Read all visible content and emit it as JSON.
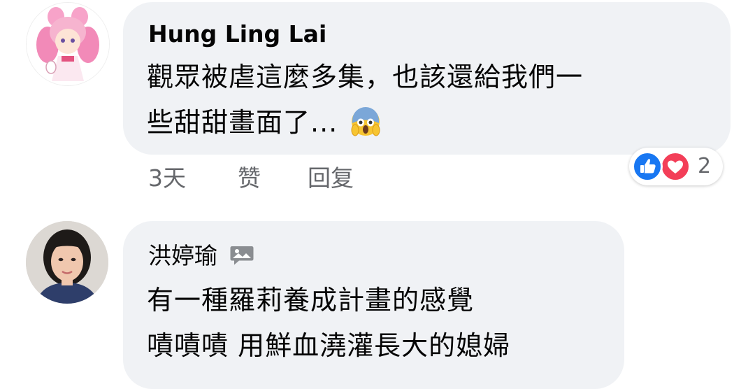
{
  "comments": [
    {
      "author": "Hung Ling Lai",
      "lines": [
        "觀眾被虐這麼多集，也該還給我們一",
        "些甜甜畫面了..."
      ],
      "emoji": "face-screaming-in-fear-icon",
      "actions": {
        "time": "3天",
        "like": "赞",
        "reply": "回复"
      },
      "reactions": {
        "icons": [
          "like-icon",
          "love-icon"
        ],
        "count": "2"
      }
    },
    {
      "author": "洪婷瑜",
      "lines": [
        "有一種羅莉養成計畫的感覺",
        "嘖嘖嘖 用鮮血澆灌長大的媳婦"
      ]
    }
  ],
  "colors": {
    "bubble": "#f0f2f5",
    "meta_text": "#65676b",
    "like_blue": "#1877f2",
    "love_red": "#f33e58"
  }
}
